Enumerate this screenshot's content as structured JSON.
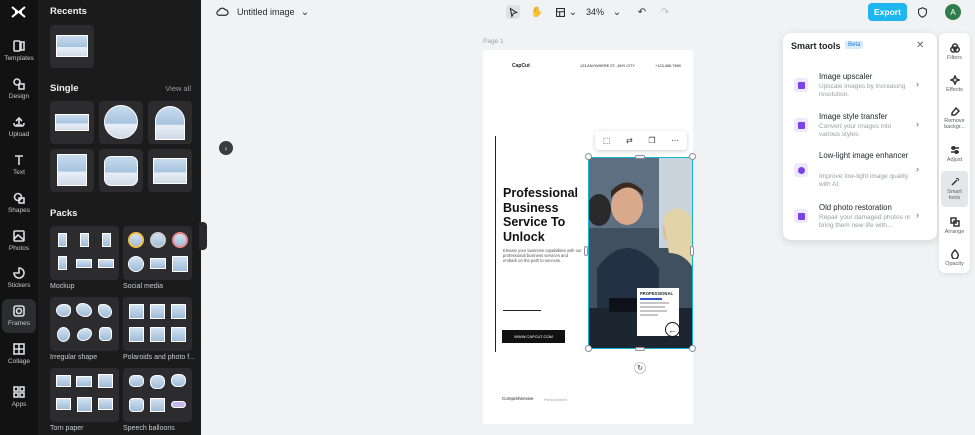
{
  "rail": {
    "items": [
      {
        "label": "Templates",
        "icon": "templates-icon"
      },
      {
        "label": "Design",
        "icon": "design-icon"
      },
      {
        "label": "Upload",
        "icon": "upload-icon"
      },
      {
        "label": "Text",
        "icon": "text-icon"
      },
      {
        "label": "Shapes",
        "icon": "shapes-icon"
      },
      {
        "label": "Photos",
        "icon": "photos-icon"
      },
      {
        "label": "Stickers",
        "icon": "stickers-icon"
      },
      {
        "label": "Frames",
        "icon": "frames-icon"
      },
      {
        "label": "Collage",
        "icon": "collage-icon"
      },
      {
        "label": "Apps",
        "icon": "apps-icon"
      }
    ],
    "active": "Frames"
  },
  "panel": {
    "recents_title": "Recents",
    "single_title": "Single",
    "view_all": "View all",
    "packs_title": "Packs",
    "packs": [
      {
        "label": "Mockup"
      },
      {
        "label": "Social media"
      },
      {
        "label": "Irregular shape"
      },
      {
        "label": "Polaroids and photo f..."
      },
      {
        "label": "Torn paper"
      },
      {
        "label": "Speech balloons"
      }
    ]
  },
  "topbar": {
    "title": "Untitled image",
    "zoom": "34%",
    "export_label": "Export",
    "avatar_letter": "A"
  },
  "canvas": {
    "page_label": "Page 1",
    "logo": "CapCut",
    "header_addr": "123 ANYWHERE ST., ANY CITY",
    "header_phone": "+123-456-7890",
    "headline": "Professional Business Service To Unlock",
    "body": "Elevate your business capabilities with our professional business services and embark on the path to success.",
    "cta": "WWW.CAPCUT.COM",
    "foot_a": "Comprehensive",
    "foot_b": "Personalized",
    "overlay_title": "PROFESSIONAL"
  },
  "smart_tools": {
    "title": "Smart tools",
    "badge": "Beta",
    "items": [
      {
        "name": "Image upscaler",
        "desc": "Upscale images by increasing resolution."
      },
      {
        "name": "Image style transfer",
        "desc": "Convert your images into various styles."
      },
      {
        "name": "Low-light image enhancer",
        "desc": "Improve low-light image quality with AI."
      },
      {
        "name": "Old photo restoration",
        "desc": "Repair your damaged photos or bring them new life with..."
      }
    ]
  },
  "right_rail": {
    "items": [
      {
        "label": "Filters"
      },
      {
        "label": "Effects"
      },
      {
        "label": "Remove backgr..."
      },
      {
        "label": "Adjust"
      },
      {
        "label": "Smart tools"
      },
      {
        "label": "Arrange"
      },
      {
        "label": "Opacity"
      }
    ],
    "active": "Smart tools"
  },
  "colors": {
    "accent": "#1fb6ef",
    "selection": "#18b4d6",
    "rail_bg": "#121212",
    "panel_bg": "#1b1b1c"
  }
}
